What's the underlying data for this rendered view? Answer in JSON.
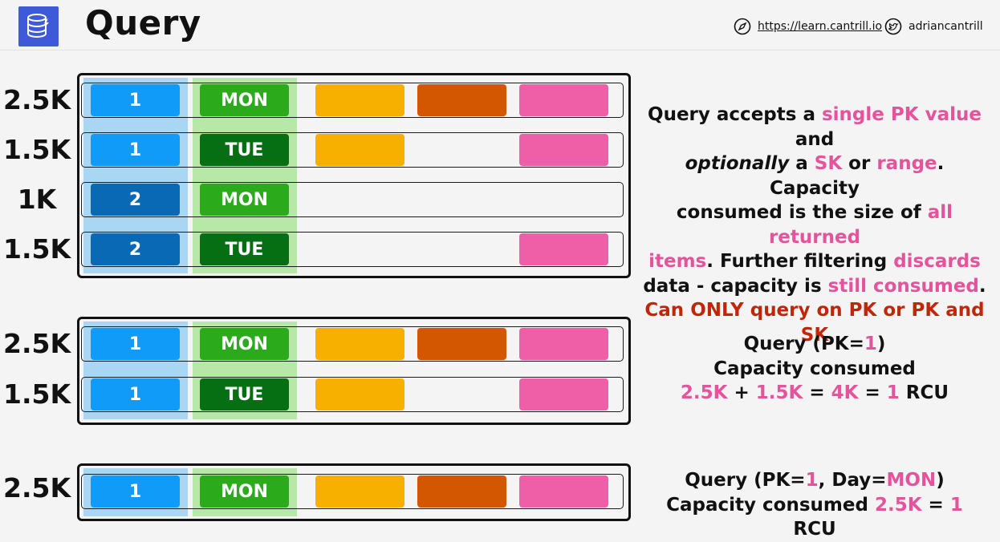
{
  "header": {
    "title": "Query",
    "url": "https://learn.cantrill.io",
    "handle": "adriancantrill"
  },
  "colors": {
    "pk_light": "#0f9bf7",
    "pk_dark": "#0a69b4",
    "sk_light": "#2bab1c",
    "sk_dark": "#066f14",
    "attr_yellow": "#f7b000",
    "attr_orange": "#d25700",
    "attr_pink": "#ee5fa7",
    "highlight_pink": "#e4539b",
    "highlight_red": "#c0270a"
  },
  "tables": [
    {
      "rows": [
        {
          "size": "2.5K",
          "pk": "1",
          "sk": "MON"
        },
        {
          "size": "1.5K",
          "pk": "1",
          "sk": "TUE"
        },
        {
          "size": "1K",
          "pk": "2",
          "sk": "MON"
        },
        {
          "size": "1.5K",
          "pk": "2",
          "sk": "TUE"
        }
      ]
    },
    {
      "rows": [
        {
          "size": "2.5K",
          "pk": "1",
          "sk": "MON"
        },
        {
          "size": "1.5K",
          "pk": "1",
          "sk": "TUE"
        }
      ]
    },
    {
      "rows": [
        {
          "size": "2.5K",
          "pk": "1",
          "sk": "MON"
        }
      ]
    }
  ],
  "desc1": {
    "l1a": "Query accepts a ",
    "l1b": "single PK value",
    "l1c": " and",
    "l2a": "optionally",
    "l2b": " a ",
    "l2c": "SK",
    "l2d": " or ",
    "l2e": "range",
    "l2f": ". Capacity",
    "l3a": "consumed is the size of ",
    "l3b": "all returned",
    "l4a": "items",
    "l4b": ". Further filtering ",
    "l4c": "discards",
    "l5a": "data - capacity is ",
    "l5b": "still consumed",
    "l5c": ".",
    "l6": "Can ONLY query on PK or PK and SK"
  },
  "desc2": {
    "l1a": "Query (PK=",
    "l1b": "1",
    "l1c": ")",
    "l2": "Capacity consumed",
    "l3a": "2.5K",
    "l3b": " + ",
    "l3c": "1.5K",
    "l3d": " = ",
    "l3e": "4K",
    "l3f": " = ",
    "l3g": "1",
    "l3h": " RCU"
  },
  "desc3": {
    "l1a": "Query (PK=",
    "l1b": "1",
    "l1c": ", Day=",
    "l1d": "MON",
    "l1e": ")",
    "l2a": "Capacity consumed ",
    "l2b": "2.5K",
    "l2c": " = ",
    "l2d": "1",
    "l2e": " RCU"
  }
}
